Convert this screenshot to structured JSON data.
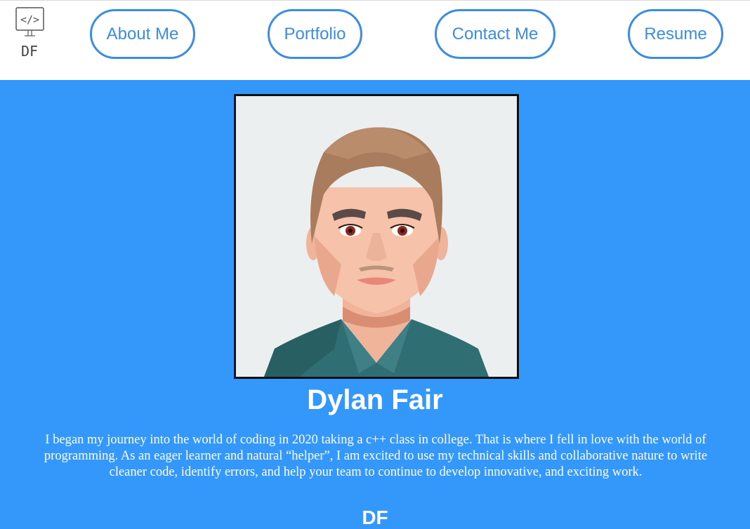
{
  "header": {
    "logo_text": "DF",
    "nav": {
      "about": "About Me",
      "portfolio": "Portfolio",
      "contact": "Contact Me",
      "resume": "Resume"
    }
  },
  "profile": {
    "name": "Dylan Fair",
    "bio": "I began my journey into the world of coding in 2020 taking a c++ class in college. That is where I fell in love with the world of programming. As an eager learner and natural “helper”, I am excited to use my technical skills and collaborative nature to write cleaner code, identify errors, and help your team to continue to develop innovative, and exciting work."
  },
  "footer": {
    "mark": "DF"
  },
  "colors": {
    "page_background": "#3498fb",
    "accent": "#3a8ee0",
    "header_background": "#ffffff"
  }
}
